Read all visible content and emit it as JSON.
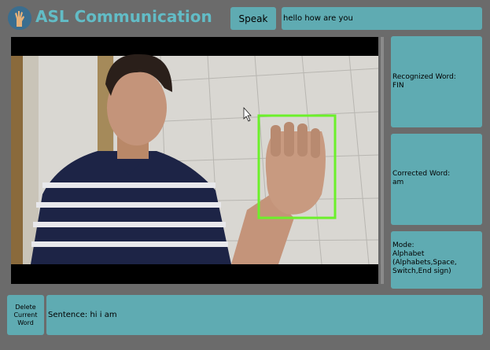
{
  "header": {
    "app_title": "ASL Communication",
    "logo_icon": "hand-sign-icon"
  },
  "speak": {
    "button_label": "Speak",
    "text": "hello how are you"
  },
  "video": {
    "camera_feed": "camera-feed",
    "detection_box_color": "#6cf02a"
  },
  "panels": {
    "recognized": {
      "label": "Recognized Word:",
      "value": "FIN"
    },
    "corrected": {
      "label": "Corrected Word:",
      "value": "am"
    },
    "mode": {
      "label": "Mode:",
      "value": "Alphabet",
      "detail": "(Alphabets,Space, Switch,End sign)"
    }
  },
  "footer": {
    "delete_label": "Delete Current Word",
    "sentence_label": "Sentence:",
    "sentence_value": "hi i am"
  },
  "colors": {
    "background": "#6b6b6b",
    "panel": "#5fabb2",
    "title": "#62bcc6"
  }
}
